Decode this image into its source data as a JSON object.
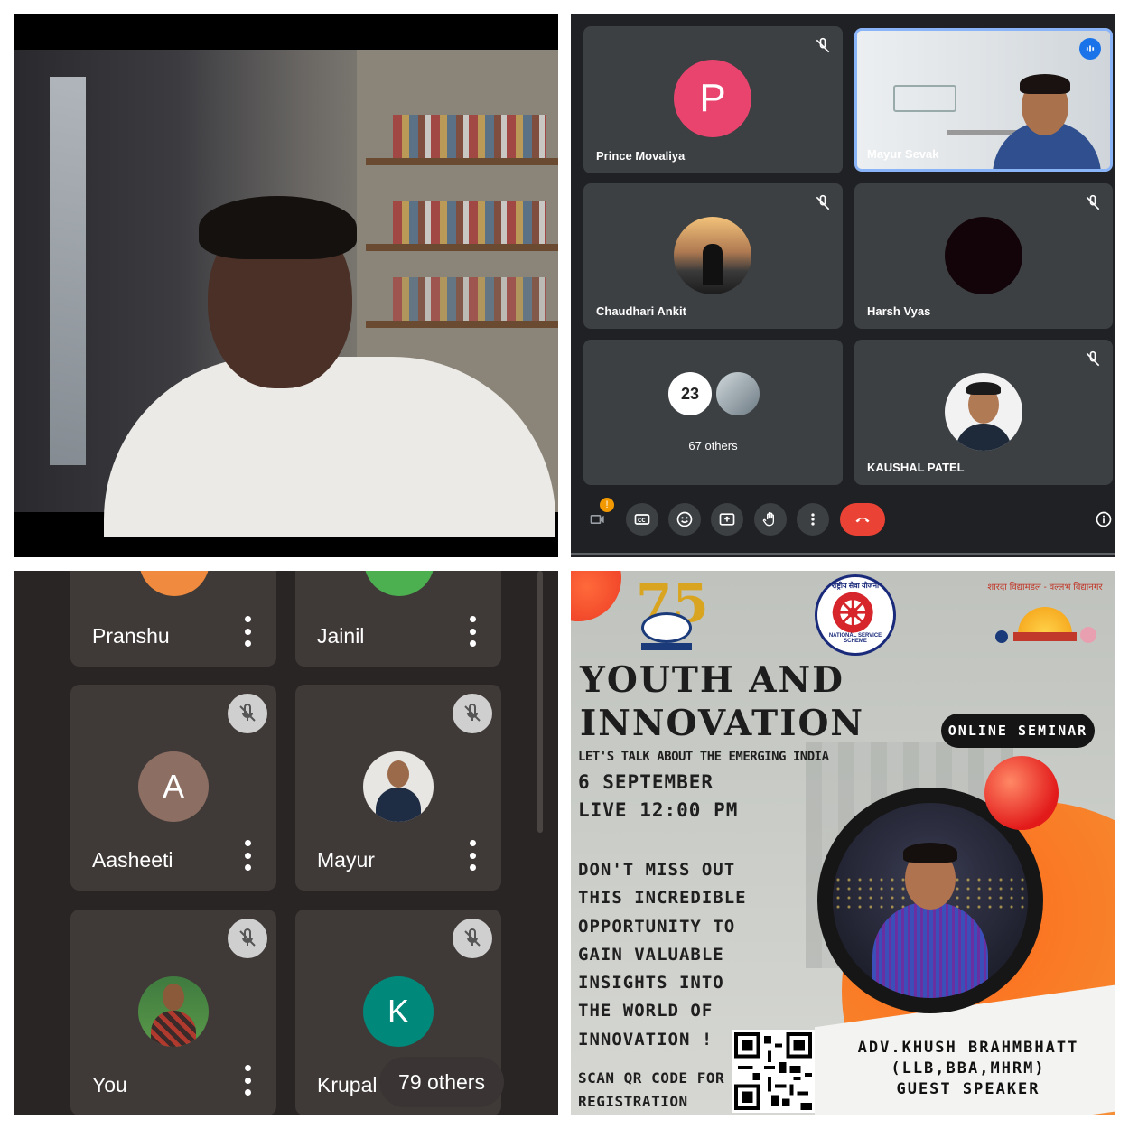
{
  "meet": {
    "participants": [
      {
        "name": "Prince Movaliya",
        "initial": "P",
        "color": "#e8446e"
      },
      {
        "name": "Mayur Sevak"
      },
      {
        "name": "Chaudhari Ankit"
      },
      {
        "name": "Harsh Vyas"
      },
      {
        "name": "KAUSHAL PATEL"
      }
    ],
    "others": {
      "label": "67 others",
      "badge": "23"
    },
    "notification_badge": "!",
    "controls": [
      "camera-icon",
      "captions-icon",
      "emoji-icon",
      "present-icon",
      "raise-hand-icon",
      "more-icon",
      "hang-up-icon",
      "info-icon"
    ],
    "accent": "#8ab4f8",
    "hangup_color": "#ea4335"
  },
  "mobile": {
    "participants": [
      {
        "name": "Pranshu",
        "color": "#f08a3e"
      },
      {
        "name": "Jainil",
        "color": "#4caf50"
      },
      {
        "name": "Aasheeti",
        "initial": "A",
        "color": "#8d6e63"
      },
      {
        "name": "Mayur"
      },
      {
        "name": "You"
      },
      {
        "name": "Krupal",
        "initial": "K",
        "color": "#00897b"
      }
    ],
    "others_label": "79 others"
  },
  "poster": {
    "title_line1": "YOUTH AND",
    "title_line2": "INNOVATION",
    "tagline": "LET'S TALK ABOUT THE EMERGING INDIA",
    "date": "6 SEPTEMBER",
    "time": "LIVE 12:00 PM",
    "body": [
      "DON'T MISS OUT",
      "THIS INCREDIBLE",
      "OPPORTUNITY TO",
      "GAIN VALUABLE",
      "INSIGHTS INTO",
      "THE WORLD OF",
      "INNOVATION !"
    ],
    "badge": "ONLINE SEMINAR",
    "qr_label_1": "SCAN QR CODE FOR",
    "qr_label_2": "REGISTRATION",
    "speaker_name": "ADV.KHUSH BRAHMBHATT",
    "speaker_degrees": "(LLB,BBA,MHRM)",
    "speaker_role": "GUEST SPEAKER",
    "logo_75": "75",
    "nss_text": "NATIONAL SERVICE SCHEME",
    "nss_hindi": "राष्ट्रीय सेवा योजना",
    "college_hindi": "शारदा विद्यामंडल - वल्लभ विद्यानगर"
  }
}
